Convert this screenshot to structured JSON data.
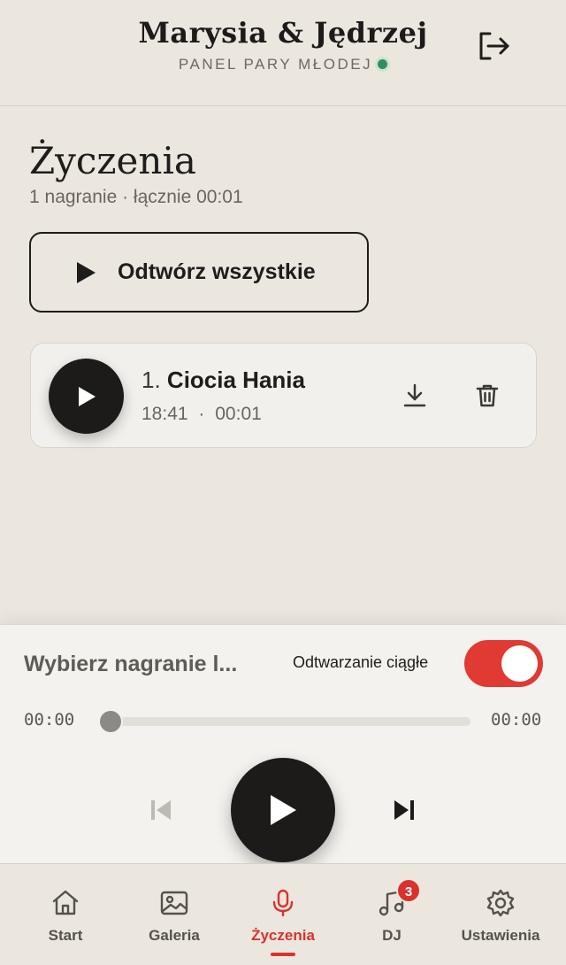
{
  "header": {
    "couple_name": "Marysia & Jędrzej",
    "subtitle": "PANEL PARY MŁODEJ",
    "status_color": "#2f8f5e"
  },
  "main": {
    "title": "Życzenia",
    "summary": "1 nagranie · łącznie 00:01",
    "play_all_label": "Odtwórz wszystkie",
    "recordings": [
      {
        "number": "1.",
        "name": "Ciocia Hania",
        "time": "18:41",
        "separator": "·",
        "duration": "00:01"
      }
    ]
  },
  "player": {
    "now_playing": "Wybierz nagranie l...",
    "continuous_label": "Odtwarzanie ciągłe",
    "continuous_on": true,
    "current_time": "00:00",
    "total_time": "00:00",
    "progress": 0,
    "accent": "#e03a33"
  },
  "nav": {
    "items": [
      {
        "label": "Start",
        "icon": "home-icon"
      },
      {
        "label": "Galeria",
        "icon": "image-icon"
      },
      {
        "label": "Życzenia",
        "icon": "microphone-icon",
        "active": true
      },
      {
        "label": "DJ",
        "icon": "music-note-icon",
        "badge": "3"
      },
      {
        "label": "Ustawienia",
        "icon": "gear-icon"
      }
    ]
  }
}
